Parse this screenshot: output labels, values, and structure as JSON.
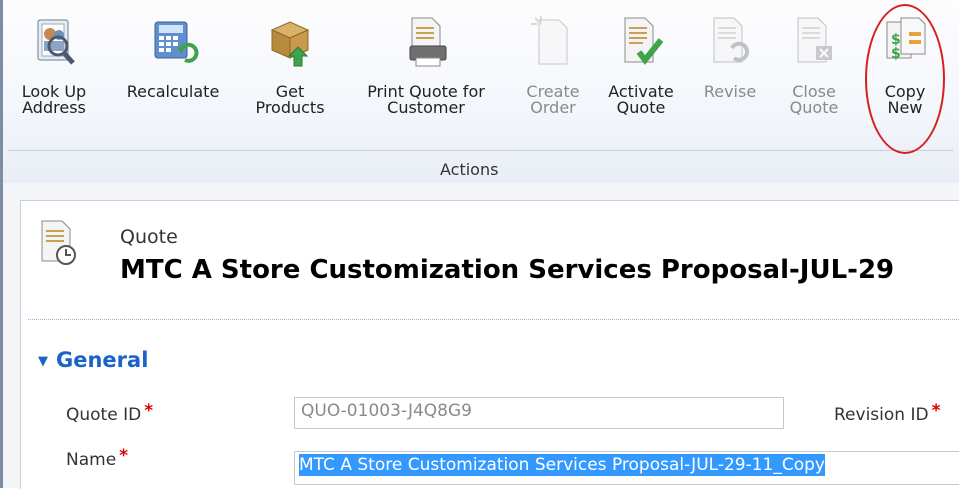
{
  "ribbon": {
    "buttons": [
      {
        "id": "look-up-address",
        "label": "Look Up\nAddress",
        "enabled": true,
        "icon": "address-book-magnifier-icon"
      },
      {
        "id": "recalculate",
        "label": "Recalculate",
        "enabled": true,
        "icon": "calculator-refresh-icon"
      },
      {
        "id": "get-products",
        "label": "Get\nProducts",
        "enabled": true,
        "icon": "box-arrow-icon"
      },
      {
        "id": "print-quote",
        "label": "Print Quote for\nCustomer",
        "enabled": true,
        "icon": "printer-document-icon"
      },
      {
        "id": "create-order",
        "label": "Create\nOrder",
        "enabled": false,
        "icon": "new-document-icon"
      },
      {
        "id": "activate-quote",
        "label": "Activate\nQuote",
        "enabled": true,
        "icon": "document-checkmark-icon"
      },
      {
        "id": "revise",
        "label": "Revise",
        "enabled": false,
        "icon": "document-revise-icon"
      },
      {
        "id": "close-quote",
        "label": "Close\nQuote",
        "enabled": false,
        "icon": "document-close-icon"
      },
      {
        "id": "copy-new",
        "label": "Copy\nNew",
        "enabled": true,
        "icon": "copy-quote-icon"
      }
    ],
    "group_label": "Actions",
    "highlight_color": "#d61f1f"
  },
  "header": {
    "entity_type": "Quote",
    "record_title": "MTC A Store Customization Services Proposal-JUL-29"
  },
  "section": {
    "title": "General",
    "fields": {
      "quote_id_label": "Quote ID",
      "quote_id_value": "QUO-01003-J4Q8G9",
      "revision_id_label": "Revision ID",
      "name_label": "Name",
      "name_value": "MTC A Store Customization Services Proposal-JUL-29-11_Copy",
      "required_marker": "*"
    }
  },
  "colors": {
    "section_heading": "#1b63c6",
    "required": "#dd0000",
    "selection": "#3399ff"
  }
}
